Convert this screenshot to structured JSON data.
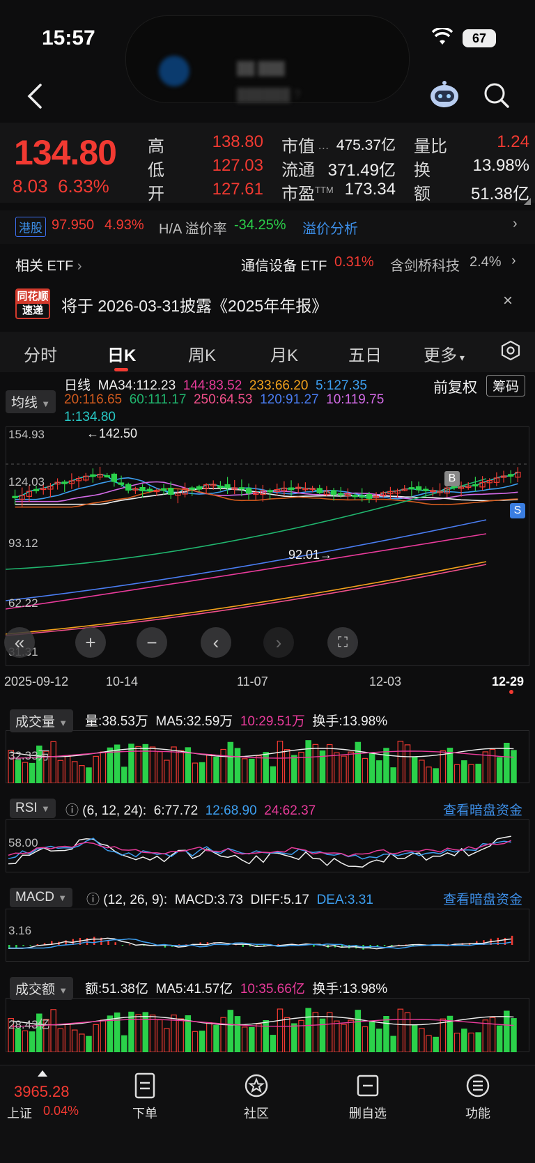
{
  "status": {
    "time": "15:57",
    "battery": "67"
  },
  "quote": {
    "price": "134.80",
    "change": "8.03",
    "change_pct": "6.33%",
    "high_label": "高",
    "high": "138.80",
    "low_label": "低",
    "low": "127.03",
    "open_label": "开",
    "open": "127.61",
    "mktcap_label": "市值",
    "mktcap": "475.37亿",
    "float_label": "流通",
    "float": "371.49亿",
    "pe_label": "市盈",
    "pe_sup": "TTM",
    "pe": "173.34",
    "volratio_label": "量比",
    "volratio": "1.24",
    "turnover_label": "换",
    "turnover": "13.98%",
    "amount_label": "额",
    "amount": "51.38亿"
  },
  "hk": {
    "tag": "港股",
    "price": "97.950",
    "pct": "4.93%",
    "premium_label": "H/A 溢价率",
    "premium": "-34.25%",
    "link": "溢价分析"
  },
  "etf": {
    "label": "相关 ETF",
    "item1_name": "通信设备 ETF",
    "item1_pct": "0.31%",
    "item2_name": "含剑桥科技",
    "item2_pct": "2.4%"
  },
  "notice": {
    "logo_top": "同花顺",
    "logo_bottom": "速递",
    "text": "将于 2026-03-31披露《2025年年报》"
  },
  "tabs": [
    "分时",
    "日K",
    "周K",
    "月K",
    "五日",
    "更多"
  ],
  "ma": {
    "selector": "均线",
    "line1": [
      "日线",
      "MA34:112.23",
      "144:83.52",
      "233:66.20",
      "5:127.35"
    ],
    "line2": [
      "20:116.65",
      "60:111.17",
      "250:64.53",
      "120:91.27",
      "10:119.75"
    ],
    "line3": "1:134.80",
    "adj": "前复权",
    "chips": "筹码"
  },
  "kline": {
    "y_labels": [
      "154.93",
      "124.03",
      "93.12",
      "62.22",
      "31.31"
    ],
    "high_mark": "←142.50",
    "low_mark": "92.01→",
    "b_marker": "B",
    "s_marker": "S",
    "dates": [
      "2025-09-12",
      "10-14",
      "11-07",
      "12-03",
      "12-29"
    ]
  },
  "volume": {
    "selector": "成交量",
    "vol": "量:38.53万",
    "ma5": "MA5:32.59万",
    "ma10": "10:29.51万",
    "turnover": "换手:13.98%",
    "y_label": "32.33万"
  },
  "rsi": {
    "selector": "RSI",
    "params": "(6, 12, 24):",
    "v6": "6:77.72",
    "v12": "12:68.90",
    "v24": "24:62.37",
    "link": "查看暗盘资金",
    "y_label": "58.00"
  },
  "macd": {
    "selector": "MACD",
    "params": "(12, 26, 9):",
    "macd": "MACD:3.73",
    "diff": "DIFF:5.17",
    "dea": "DEA:3.31",
    "link": "查看暗盘资金",
    "y_label": "3.16"
  },
  "amount": {
    "selector": "成交额",
    "amt": "额:51.38亿",
    "ma5": "MA5:41.57亿",
    "ma10": "10:35.66亿",
    "turnover": "换手:13.98%",
    "y_label": "28.43亿"
  },
  "bottom": {
    "index_value": "3965.28",
    "index_name": "上证",
    "index_pct": "0.04%",
    "nav": [
      "下单",
      "社区",
      "删自选",
      "功能"
    ]
  },
  "colors": {
    "up": "#f23a32",
    "down": "#2bd14a",
    "accent_blue": "#3d8fe8"
  }
}
